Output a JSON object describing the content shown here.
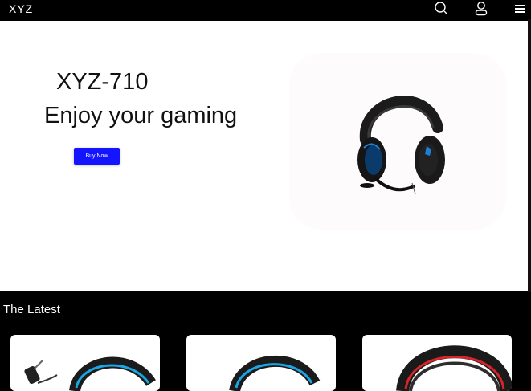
{
  "header": {
    "logo": "XYZ",
    "icons": [
      "search-icon",
      "user-icon",
      "menu-icon"
    ]
  },
  "hero": {
    "model": "XYZ-710",
    "tagline": "Enjoy your gaming",
    "cta_label": "Buy Now",
    "cta_color": "#1414ff"
  },
  "latest": {
    "title": "The Latest",
    "products": [
      {
        "image": "headset-blue-usb"
      },
      {
        "image": "headset-blue"
      },
      {
        "image": "headset-red"
      }
    ]
  },
  "colors": {
    "background": "#000000",
    "hero_background": "#ffffff",
    "accent": "#1414ff"
  }
}
